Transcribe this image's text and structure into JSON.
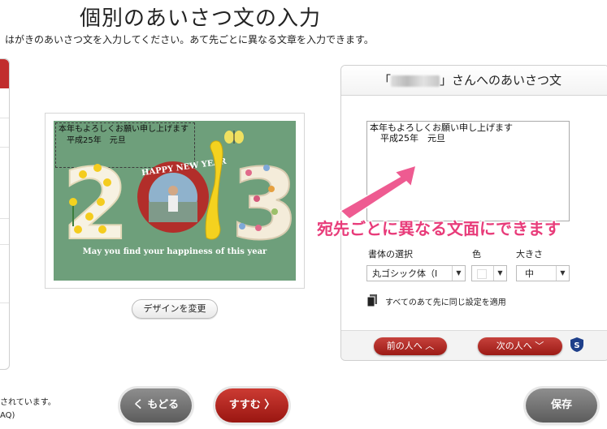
{
  "page": {
    "title": "個別のあいさつ文の入力",
    "subtitle": "はがきのあいさつ文を入力してください。あて先ごとに異なる文章を入力できます。"
  },
  "left_notes": {
    "line1": "されています。",
    "line2": "AQ)"
  },
  "card": {
    "message_line1": "本年もよろしくお願い申し上げます",
    "message_line2": "平成25年　元旦",
    "banner_text": "HAPPY NEW YEAR",
    "tagline": "May you find your happiness of this year",
    "year_digit_2": "2",
    "year_digit_3": "3"
  },
  "change_design_button": "デザインを変更",
  "panel": {
    "header_open": "「",
    "header_close": "」さんへのあいさつ文",
    "message_line1": "本年もよろしくお願い申し上げます",
    "message_line2": "平成25年　元旦",
    "font_label": "書体の選択",
    "font_value": "丸ゴシック体（I",
    "color_label": "色",
    "size_label": "大きさ",
    "size_value": "中",
    "apply_all": "すべてのあて先に同じ設定を適用",
    "prev_button": "前の人へ ︿",
    "next_person_button": "次の人へ ﹀",
    "help_icon_letter": "S"
  },
  "callout_text": "宛先ごとに異なる文面にできます",
  "buttons": {
    "back": "く もどる",
    "next": "すすむ 〉",
    "save": "保存"
  },
  "colors": {
    "card_bg": "#6e9f7b",
    "brand_red": "#c12d2d",
    "callout_pink": "#e83c7a",
    "snake_yellow": "#f4d21f"
  }
}
